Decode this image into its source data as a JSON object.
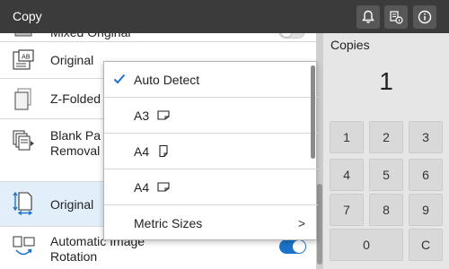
{
  "header": {
    "title": "Copy",
    "icons": [
      "bell-icon",
      "job-status-icon",
      "info-icon"
    ]
  },
  "list": {
    "items": [
      {
        "label": "Mixed Original",
        "icon": "mixed-original-icon",
        "toggle": "off"
      },
      {
        "label": "Original",
        "icon": "original-type-icon"
      },
      {
        "label": "Z-Folded",
        "icon": "z-folded-icon"
      },
      {
        "label_line1": "Blank Pa",
        "label_line2": "Removal",
        "icon": "blank-page-removal-icon"
      },
      {
        "label": "Original",
        "icon": "original-size-icon",
        "selected": true
      },
      {
        "label_line1": "Automatic Image",
        "label_line2": "Rotation",
        "icon": "auto-rotation-icon",
        "toggle": "on"
      }
    ]
  },
  "dropdown": {
    "items": [
      {
        "label": "Auto  Detect",
        "checked": true
      },
      {
        "label": "A3",
        "icon": "landscape-paper-icon"
      },
      {
        "label": "A4",
        "icon": "portrait-paper-icon"
      },
      {
        "label": "A4",
        "icon": "landscape-paper-icon"
      },
      {
        "label": "Metric  Sizes",
        "submenu": true,
        "chevron": ">"
      }
    ]
  },
  "copies": {
    "title": "Copies",
    "value": "1",
    "keys": [
      "1",
      "2",
      "3",
      "4",
      "5",
      "6",
      "7",
      "8",
      "9",
      "0",
      "C"
    ]
  },
  "colors": {
    "header_bg": "#3b3b3b",
    "accent": "#1a73c9",
    "selected_row": "#e3eefb"
  }
}
